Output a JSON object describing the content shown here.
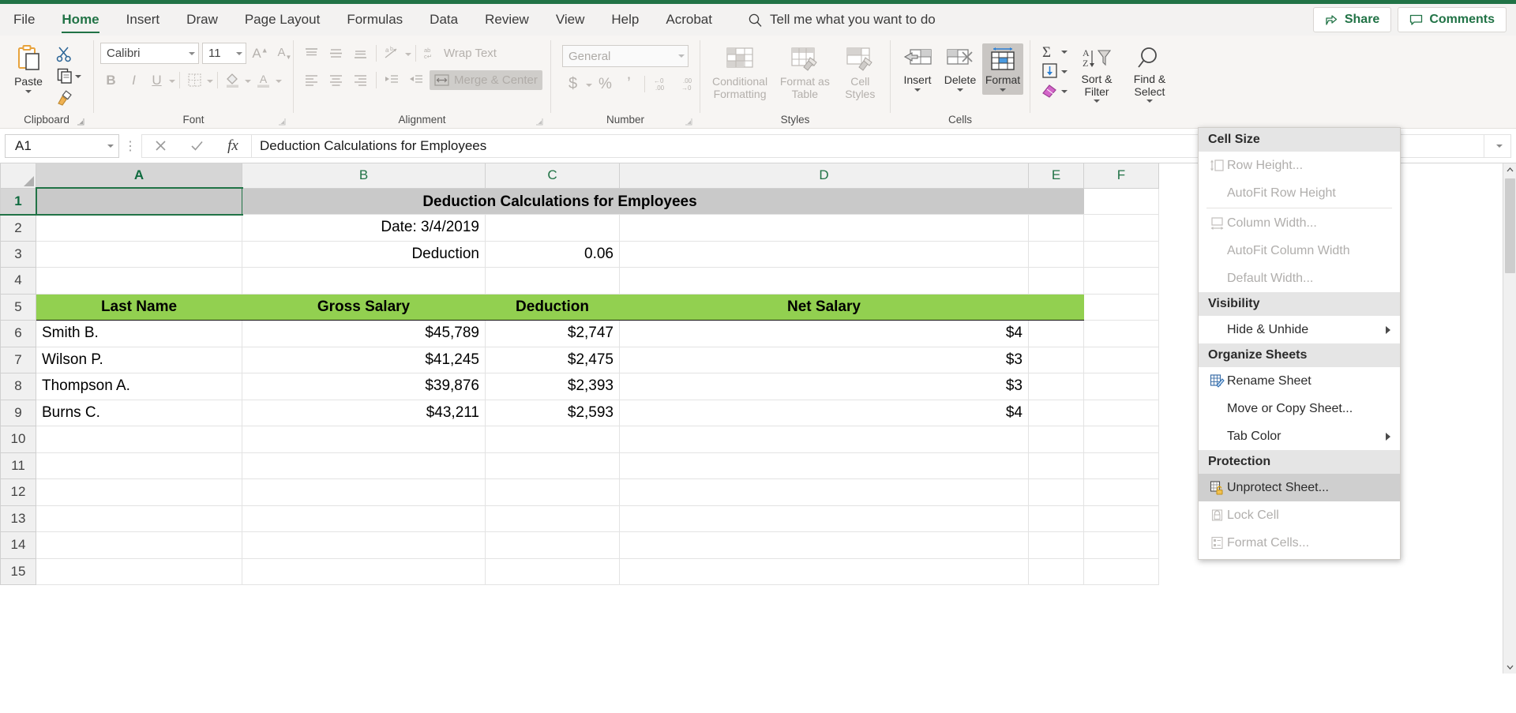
{
  "app": {
    "accent_green": "#217346",
    "header_fill_green": "#92D050",
    "selected_row_fill": "#C9C9C9"
  },
  "tabs": [
    {
      "label": "File",
      "active": false
    },
    {
      "label": "Home",
      "active": true
    },
    {
      "label": "Insert",
      "active": false
    },
    {
      "label": "Draw",
      "active": false
    },
    {
      "label": "Page Layout",
      "active": false
    },
    {
      "label": "Formulas",
      "active": false
    },
    {
      "label": "Data",
      "active": false
    },
    {
      "label": "Review",
      "active": false
    },
    {
      "label": "View",
      "active": false
    },
    {
      "label": "Help",
      "active": false
    },
    {
      "label": "Acrobat",
      "active": false
    }
  ],
  "tellme": {
    "label": "Tell me what you want to do",
    "icon": "search-icon"
  },
  "topright": {
    "share": {
      "label": "Share",
      "icon": "share-icon"
    },
    "comments": {
      "label": "Comments",
      "icon": "comment-icon"
    }
  },
  "ribbon": {
    "clipboard": {
      "group_label": "Clipboard",
      "paste_label": "Paste",
      "cut_label": "Cut",
      "copy_label": "Copy",
      "format_painter_label": "Format Painter"
    },
    "font": {
      "group_label": "Font",
      "font_family": "Calibri",
      "font_size": "11",
      "grow_label": "A",
      "shrink_label": "A",
      "bold_label": "B",
      "italic_label": "I",
      "underline_label": "U",
      "borders_label": "Borders",
      "fill_color_label": "Fill Color",
      "font_color_label": "A"
    },
    "alignment": {
      "group_label": "Alignment",
      "wrap_text_label": "Wrap Text",
      "merge_center_label": "Merge & Center",
      "orientation_label": "Orientation"
    },
    "number": {
      "group_label": "Number",
      "format_value": "General",
      "currency_label": "$",
      "percent_label": "%",
      "comma_label": ",",
      "increase_decimal_label": ".00",
      "decrease_decimal_label": ".00"
    },
    "styles": {
      "group_label": "Styles",
      "conditional_formatting_label": "Conditional Formatting",
      "format_as_table_label": "Format as Table",
      "cell_styles_label": "Cell Styles"
    },
    "cells": {
      "group_label": "Cells",
      "insert_label": "Insert",
      "delete_label": "Delete",
      "format_label": "Format"
    },
    "editing": {
      "autosum_label": "AutoSum",
      "fill_label": "Fill",
      "clear_label": "Clear",
      "sort_filter_label": "Sort & Filter",
      "find_select_label": "Find & Select"
    }
  },
  "formula_bar": {
    "name_box_value": "A1",
    "cancel_label": "✕",
    "enter_label": "✓",
    "fx_label": "fx",
    "formula_value": "Deduction Calculations for Employees"
  },
  "format_menu": {
    "sections": [
      {
        "title": "Cell Size",
        "items": [
          {
            "label": "Row Height...",
            "mnemonic": "H",
            "icon": "row-height-icon",
            "disabled": true,
            "submenu": false,
            "highlighted": false
          },
          {
            "label": "AutoFit Row Height",
            "mnemonic": "A",
            "icon": "",
            "disabled": true,
            "submenu": false,
            "highlighted": false
          },
          {
            "label": "Column Width...",
            "mnemonic": "W",
            "icon": "column-width-icon",
            "disabled": true,
            "submenu": false,
            "highlighted": false
          },
          {
            "label": "AutoFit Column Width",
            "mnemonic": "I",
            "icon": "",
            "disabled": true,
            "submenu": false,
            "highlighted": false
          },
          {
            "label": "Default Width...",
            "mnemonic": "D",
            "icon": "",
            "disabled": true,
            "submenu": false,
            "highlighted": false
          }
        ]
      },
      {
        "title": "Visibility",
        "items": [
          {
            "label": "Hide & Unhide",
            "mnemonic": "U",
            "icon": "",
            "disabled": false,
            "submenu": true,
            "highlighted": false
          }
        ]
      },
      {
        "title": "Organize Sheets",
        "items": [
          {
            "label": "Rename Sheet",
            "mnemonic": "R",
            "icon": "rename-sheet-icon",
            "disabled": false,
            "submenu": false,
            "highlighted": false
          },
          {
            "label": "Move or Copy Sheet...",
            "mnemonic": "M",
            "icon": "",
            "disabled": false,
            "submenu": false,
            "highlighted": false
          },
          {
            "label": "Tab Color",
            "mnemonic": "T",
            "icon": "",
            "disabled": false,
            "submenu": true,
            "highlighted": false
          }
        ]
      },
      {
        "title": "Protection",
        "items": [
          {
            "label": "Unprotect Sheet...",
            "mnemonic": "P",
            "icon": "unprotect-sheet-icon",
            "disabled": false,
            "submenu": false,
            "highlighted": true
          },
          {
            "label": "Lock Cell",
            "mnemonic": "L",
            "icon": "lock-cell-icon",
            "disabled": true,
            "submenu": false,
            "highlighted": false
          },
          {
            "label": "Format Cells...",
            "mnemonic": "E",
            "icon": "format-cells-icon",
            "disabled": true,
            "submenu": false,
            "highlighted": false
          }
        ]
      }
    ]
  },
  "grid": {
    "column_headers": [
      "A",
      "B",
      "C",
      "D",
      "E",
      "F"
    ],
    "row_numbers": [
      "1",
      "2",
      "3",
      "4",
      "5",
      "6",
      "7",
      "8",
      "9",
      "10",
      "11",
      "12",
      "13",
      "14",
      "15"
    ],
    "selected_cell": "A1",
    "rows": [
      {
        "n": "1",
        "cells": [
          {
            "col": "A",
            "text": "",
            "style": "title-merged"
          },
          {
            "col": "B",
            "text": "Deduction Calculations for Employees",
            "style": "title-merged"
          },
          {
            "col": "C",
            "text": "",
            "style": "title-merged"
          },
          {
            "col": "D",
            "text": "",
            "style": "title-merged"
          },
          {
            "col": "E",
            "text": "",
            "style": "title-merged"
          },
          {
            "col": "F",
            "text": "",
            "style": "blank"
          }
        ]
      },
      {
        "n": "2",
        "cells": [
          {
            "col": "A",
            "text": "",
            "style": "blank"
          },
          {
            "col": "B",
            "text": "Date: 3/4/2019",
            "style": "right"
          },
          {
            "col": "C",
            "text": "",
            "style": "blank"
          },
          {
            "col": "D",
            "text": "",
            "style": "blank"
          },
          {
            "col": "E",
            "text": "",
            "style": "blank"
          },
          {
            "col": "F",
            "text": "",
            "style": "blank"
          }
        ]
      },
      {
        "n": "3",
        "cells": [
          {
            "col": "A",
            "text": "",
            "style": "blank"
          },
          {
            "col": "B",
            "text": "Deduction",
            "style": "right"
          },
          {
            "col": "C",
            "text": "0.06",
            "style": "right"
          },
          {
            "col": "D",
            "text": "",
            "style": "blank"
          },
          {
            "col": "E",
            "text": "",
            "style": "blank"
          },
          {
            "col": "F",
            "text": "",
            "style": "blank"
          }
        ]
      },
      {
        "n": "4",
        "cells": [
          {
            "col": "A",
            "text": "",
            "style": "blank"
          },
          {
            "col": "B",
            "text": "",
            "style": "blank"
          },
          {
            "col": "C",
            "text": "",
            "style": "blank"
          },
          {
            "col": "D",
            "text": "",
            "style": "blank"
          },
          {
            "col": "E",
            "text": "",
            "style": "blank"
          },
          {
            "col": "F",
            "text": "",
            "style": "blank"
          }
        ]
      },
      {
        "n": "5",
        "cells": [
          {
            "col": "A",
            "text": "Last Name",
            "style": "header"
          },
          {
            "col": "B",
            "text": "Gross Salary",
            "style": "header"
          },
          {
            "col": "C",
            "text": "Deduction",
            "style": "header"
          },
          {
            "col": "D",
            "text": "Net Salary",
            "style": "header"
          },
          {
            "col": "E",
            "text": "",
            "style": "header"
          },
          {
            "col": "F",
            "text": "",
            "style": "blank"
          }
        ]
      },
      {
        "n": "6",
        "cells": [
          {
            "col": "A",
            "text": "Smith B.",
            "style": "left"
          },
          {
            "col": "B",
            "text": "$45,789",
            "style": "right"
          },
          {
            "col": "C",
            "text": "$2,747",
            "style": "right"
          },
          {
            "col": "D",
            "text": "$4",
            "style": "right-clip"
          },
          {
            "col": "E",
            "text": "",
            "style": "blank"
          },
          {
            "col": "F",
            "text": "",
            "style": "blank"
          }
        ]
      },
      {
        "n": "7",
        "cells": [
          {
            "col": "A",
            "text": "Wilson P.",
            "style": "left"
          },
          {
            "col": "B",
            "text": "$41,245",
            "style": "right"
          },
          {
            "col": "C",
            "text": "$2,475",
            "style": "right"
          },
          {
            "col": "D",
            "text": "$3",
            "style": "right-clip"
          },
          {
            "col": "E",
            "text": "",
            "style": "blank"
          },
          {
            "col": "F",
            "text": "",
            "style": "blank"
          }
        ]
      },
      {
        "n": "8",
        "cells": [
          {
            "col": "A",
            "text": "Thompson A.",
            "style": "left"
          },
          {
            "col": "B",
            "text": "$39,876",
            "style": "right"
          },
          {
            "col": "C",
            "text": "$2,393",
            "style": "right"
          },
          {
            "col": "D",
            "text": "$3",
            "style": "right-clip"
          },
          {
            "col": "E",
            "text": "",
            "style": "blank"
          },
          {
            "col": "F",
            "text": "",
            "style": "blank"
          }
        ]
      },
      {
        "n": "9",
        "cells": [
          {
            "col": "A",
            "text": "Burns C.",
            "style": "left"
          },
          {
            "col": "B",
            "text": "$43,211",
            "style": "right"
          },
          {
            "col": "C",
            "text": "$2,593",
            "style": "right"
          },
          {
            "col": "D",
            "text": "$4",
            "style": "right-clip"
          },
          {
            "col": "E",
            "text": "",
            "style": "blank"
          },
          {
            "col": "F",
            "text": "",
            "style": "blank"
          }
        ]
      },
      {
        "n": "10",
        "cells": [
          {
            "col": "A",
            "text": "",
            "style": "blank"
          },
          {
            "col": "B",
            "text": "",
            "style": "blank"
          },
          {
            "col": "C",
            "text": "",
            "style": "blank"
          },
          {
            "col": "D",
            "text": "",
            "style": "blank"
          },
          {
            "col": "E",
            "text": "",
            "style": "blank"
          },
          {
            "col": "F",
            "text": "",
            "style": "blank"
          }
        ]
      },
      {
        "n": "11",
        "cells": [
          {
            "col": "A",
            "text": "",
            "style": "blank"
          },
          {
            "col": "B",
            "text": "",
            "style": "blank"
          },
          {
            "col": "C",
            "text": "",
            "style": "blank"
          },
          {
            "col": "D",
            "text": "",
            "style": "blank"
          },
          {
            "col": "E",
            "text": "",
            "style": "blank"
          },
          {
            "col": "F",
            "text": "",
            "style": "blank"
          }
        ]
      },
      {
        "n": "12",
        "cells": [
          {
            "col": "A",
            "text": "",
            "style": "blank"
          },
          {
            "col": "B",
            "text": "",
            "style": "blank"
          },
          {
            "col": "C",
            "text": "",
            "style": "blank"
          },
          {
            "col": "D",
            "text": "",
            "style": "blank"
          },
          {
            "col": "E",
            "text": "",
            "style": "blank"
          },
          {
            "col": "F",
            "text": "",
            "style": "blank"
          }
        ]
      },
      {
        "n": "13",
        "cells": [
          {
            "col": "A",
            "text": "",
            "style": "blank"
          },
          {
            "col": "B",
            "text": "",
            "style": "blank"
          },
          {
            "col": "C",
            "text": "",
            "style": "blank"
          },
          {
            "col": "D",
            "text": "",
            "style": "blank"
          },
          {
            "col": "E",
            "text": "",
            "style": "blank"
          },
          {
            "col": "F",
            "text": "",
            "style": "blank"
          }
        ]
      },
      {
        "n": "14",
        "cells": [
          {
            "col": "A",
            "text": "",
            "style": "blank"
          },
          {
            "col": "B",
            "text": "",
            "style": "blank"
          },
          {
            "col": "C",
            "text": "",
            "style": "blank"
          },
          {
            "col": "D",
            "text": "",
            "style": "blank"
          },
          {
            "col": "E",
            "text": "",
            "style": "blank"
          },
          {
            "col": "F",
            "text": "",
            "style": "blank"
          }
        ]
      },
      {
        "n": "15",
        "cells": [
          {
            "col": "A",
            "text": "",
            "style": "blank"
          },
          {
            "col": "B",
            "text": "",
            "style": "blank"
          },
          {
            "col": "C",
            "text": "",
            "style": "blank"
          },
          {
            "col": "D",
            "text": "",
            "style": "blank"
          },
          {
            "col": "E",
            "text": "",
            "style": "blank"
          },
          {
            "col": "F",
            "text": "",
            "style": "blank"
          }
        ]
      }
    ]
  }
}
